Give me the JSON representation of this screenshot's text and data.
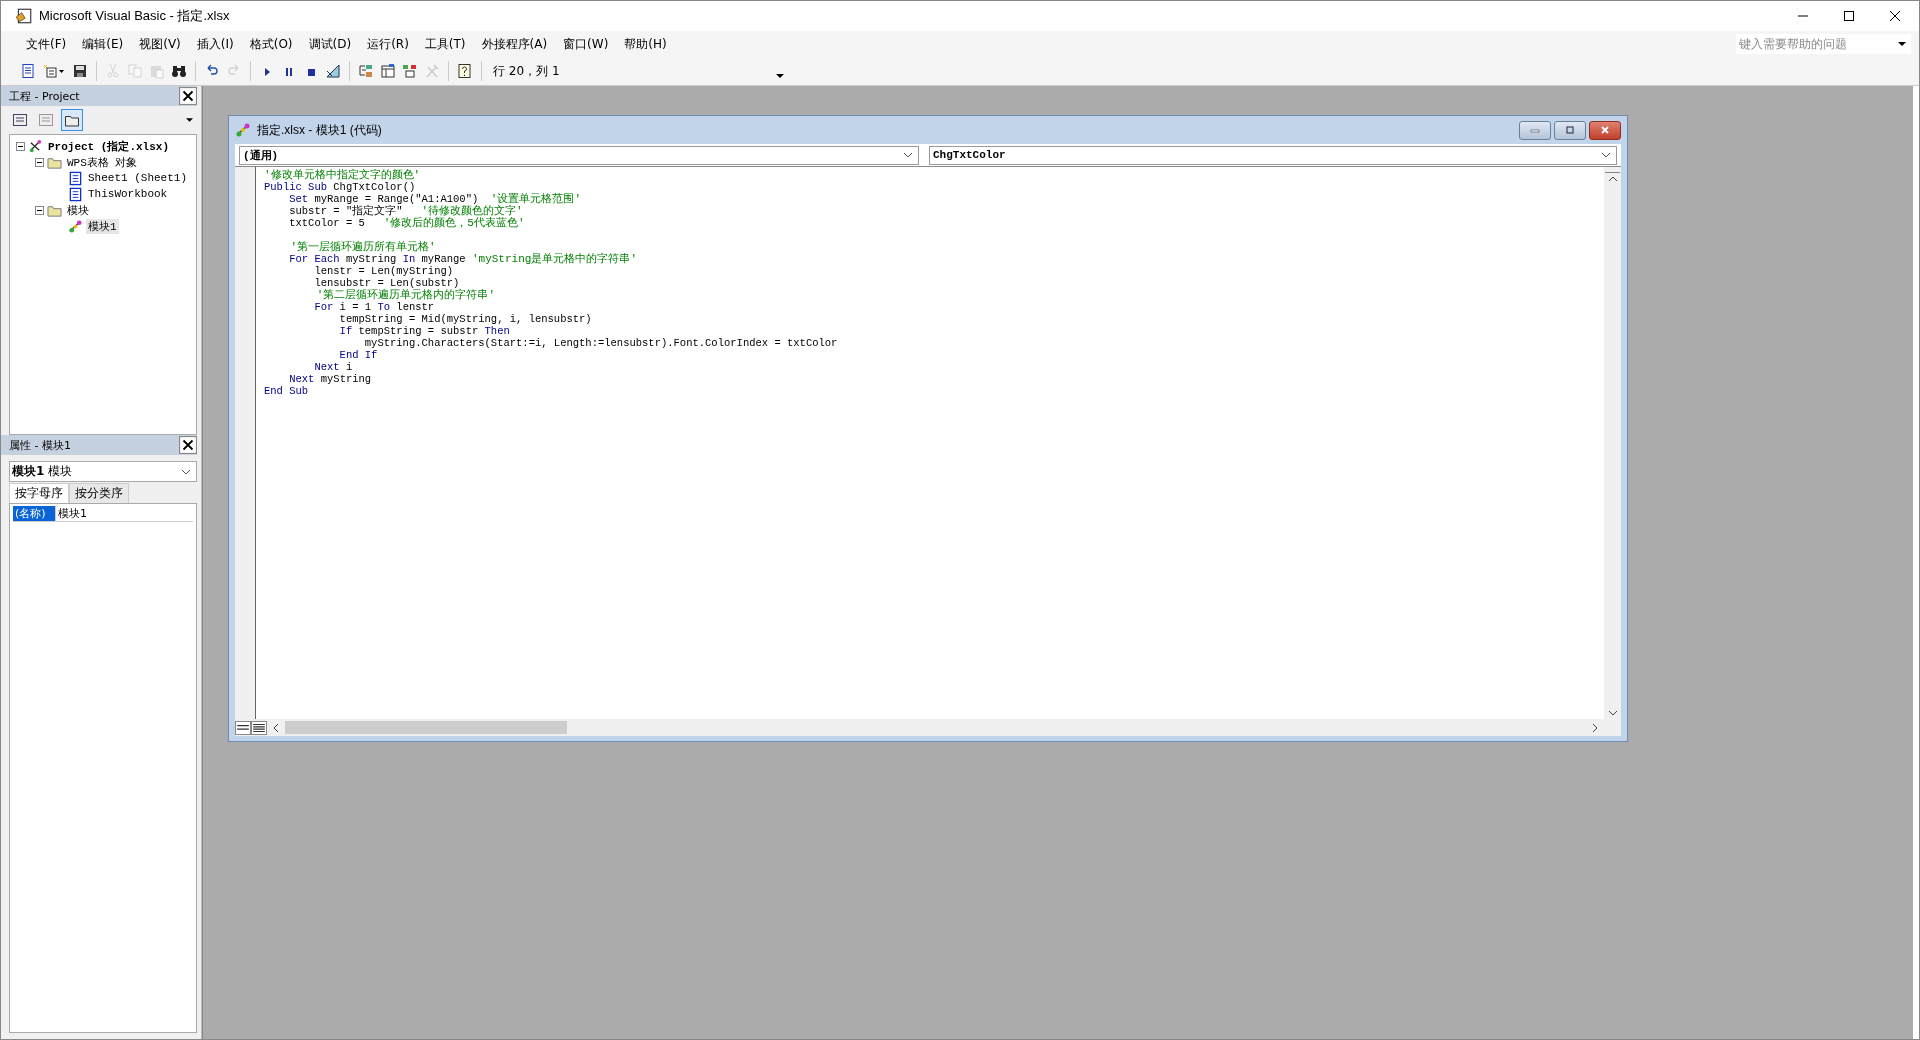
{
  "window": {
    "title": "Microsoft Visual Basic - 指定.xlsx"
  },
  "menu": [
    "文件(F)",
    "编辑(E)",
    "视图(V)",
    "插入(I)",
    "格式(O)",
    "调试(D)",
    "运行(R)",
    "工具(T)",
    "外接程序(A)",
    "窗口(W)",
    "帮助(H)"
  ],
  "help_box": {
    "placeholder": "键入需要帮助的问题"
  },
  "toolbar_groups": [
    [
      {
        "kind": "new-doc",
        "disabled": false
      },
      {
        "kind": "insert",
        "disabled": false
      },
      {
        "kind": "save",
        "disabled": false
      }
    ],
    [
      {
        "kind": "cut",
        "disabled": true
      },
      {
        "kind": "copy",
        "disabled": true
      },
      {
        "kind": "paste",
        "disabled": true
      },
      {
        "kind": "find",
        "disabled": false
      }
    ],
    [
      {
        "kind": "undo",
        "disabled": false
      },
      {
        "kind": "redo",
        "disabled": true
      }
    ],
    [
      {
        "kind": "run",
        "disabled": false
      },
      {
        "kind": "pause",
        "disabled": false
      },
      {
        "kind": "stop",
        "disabled": false
      },
      {
        "kind": "design",
        "disabled": false
      }
    ],
    [
      {
        "kind": "explorer",
        "disabled": false
      },
      {
        "kind": "properties",
        "disabled": false
      },
      {
        "kind": "browser",
        "disabled": false
      },
      {
        "kind": "tools",
        "disabled": true
      }
    ],
    [
      {
        "kind": "help",
        "disabled": false
      }
    ]
  ],
  "cursor_position": "行 20，列 1",
  "project_panel": {
    "title": "工程 - Project",
    "buttons": [
      {
        "kind": "view-code",
        "selected": false
      },
      {
        "kind": "view-object",
        "selected": false
      },
      {
        "kind": "toggle-folders",
        "selected": true
      }
    ],
    "tree": [
      {
        "kind": "project",
        "label": "Project (指定.xlsx)",
        "selected": false,
        "expanded": true,
        "children": [
          {
            "kind": "folder",
            "label": "WPS表格 对象",
            "selected": false,
            "expanded": true,
            "children": [
              {
                "kind": "sheet",
                "label": "Sheet1 (Sheet1)",
                "selected": false
              },
              {
                "kind": "sheet",
                "label": "ThisWorkbook",
                "selected": false
              }
            ]
          },
          {
            "kind": "folder",
            "label": "模块",
            "selected": false,
            "expanded": true,
            "children": [
              {
                "kind": "module",
                "label": "模块1",
                "selected": true
              }
            ]
          }
        ]
      }
    ]
  },
  "properties_panel": {
    "title": "属性 - 模块1",
    "object": "**模块1** 模块",
    "tabs": [
      {
        "label": "按字母序",
        "selected": true
      },
      {
        "label": "按分类序",
        "selected": false
      }
    ],
    "rows": [
      {
        "name": "(名称)",
        "value": "模块1",
        "selected": true
      }
    ]
  },
  "code_window": {
    "title": "指定.xlsx - 模块1 (代码)",
    "object": "(通用)",
    "procedure": "ChgTxtColor",
    "lines": [
      {
        "kind": "code",
        "segments": [
          {
            "kind": "comment",
            "text": "'修改单元格中指定文字的颜色'"
          }
        ]
      },
      {
        "kind": "code",
        "segments": [
          {
            "kind": "keyword",
            "text": "Public Sub"
          },
          {
            "kind": "text",
            "text": " ChgTxtColor()"
          }
        ]
      },
      {
        "kind": "code",
        "segments": [
          {
            "kind": "keyword",
            "text": "    Set"
          },
          {
            "kind": "text",
            "text": " myRange = Range(\"A1:A100\")  "
          },
          {
            "kind": "comment",
            "text": "'设置单元格范围'"
          }
        ]
      },
      {
        "kind": "code",
        "segments": [
          {
            "kind": "text",
            "text": "    substr = \"指定文字\"   "
          },
          {
            "kind": "comment",
            "text": "'待修改颜色的文字'"
          }
        ]
      },
      {
        "kind": "code",
        "segments": [
          {
            "kind": "text",
            "text": "    txtColor = 5   "
          },
          {
            "kind": "comment",
            "text": "'修改后的颜色，5代表蓝色'"
          }
        ]
      },
      {
        "kind": "blank"
      },
      {
        "kind": "code",
        "segments": [
          {
            "kind": "comment",
            "text": "    '第一层循环遍历所有单元格'"
          }
        ]
      },
      {
        "kind": "code",
        "segments": [
          {
            "kind": "keyword",
            "text": "    For Each"
          },
          {
            "kind": "text",
            "text": " myString "
          },
          {
            "kind": "keyword",
            "text": "In"
          },
          {
            "kind": "text",
            "text": " myRange "
          },
          {
            "kind": "comment",
            "text": "'myString是单元格中的字符串'"
          }
        ]
      },
      {
        "kind": "code",
        "segments": [
          {
            "kind": "text",
            "text": "        lenstr = Len(myString)"
          }
        ]
      },
      {
        "kind": "code",
        "segments": [
          {
            "kind": "text",
            "text": "        lensubstr = Len(substr)"
          }
        ]
      },
      {
        "kind": "code",
        "segments": [
          {
            "kind": "comment",
            "text": "        '第二层循环遍历单元格内的字符串'"
          }
        ]
      },
      {
        "kind": "code",
        "segments": [
          {
            "kind": "keyword",
            "text": "        For"
          },
          {
            "kind": "text",
            "text": " i = 1 "
          },
          {
            "kind": "keyword",
            "text": "To"
          },
          {
            "kind": "text",
            "text": " lenstr"
          }
        ]
      },
      {
        "kind": "code",
        "segments": [
          {
            "kind": "text",
            "text": "            tempString = Mid(myString, i, lensubstr)"
          }
        ]
      },
      {
        "kind": "code",
        "segments": [
          {
            "kind": "keyword",
            "text": "            If"
          },
          {
            "kind": "text",
            "text": " tempString = substr "
          },
          {
            "kind": "keyword",
            "text": "Then"
          }
        ]
      },
      {
        "kind": "code",
        "segments": [
          {
            "kind": "text",
            "text": "                myString.Characters(Start:=i, Length:=lensubstr).Font.ColorIndex = txtColor"
          }
        ]
      },
      {
        "kind": "code",
        "segments": [
          {
            "kind": "keyword",
            "text": "            End If"
          }
        ]
      },
      {
        "kind": "code",
        "segments": [
          {
            "kind": "keyword",
            "text": "        Next"
          },
          {
            "kind": "text",
            "text": " i"
          }
        ]
      },
      {
        "kind": "code",
        "segments": [
          {
            "kind": "keyword",
            "text": "    Next"
          },
          {
            "kind": "text",
            "text": " myString"
          }
        ]
      },
      {
        "kind": "code",
        "segments": [
          {
            "kind": "keyword",
            "text": "End Sub"
          }
        ]
      }
    ]
  }
}
